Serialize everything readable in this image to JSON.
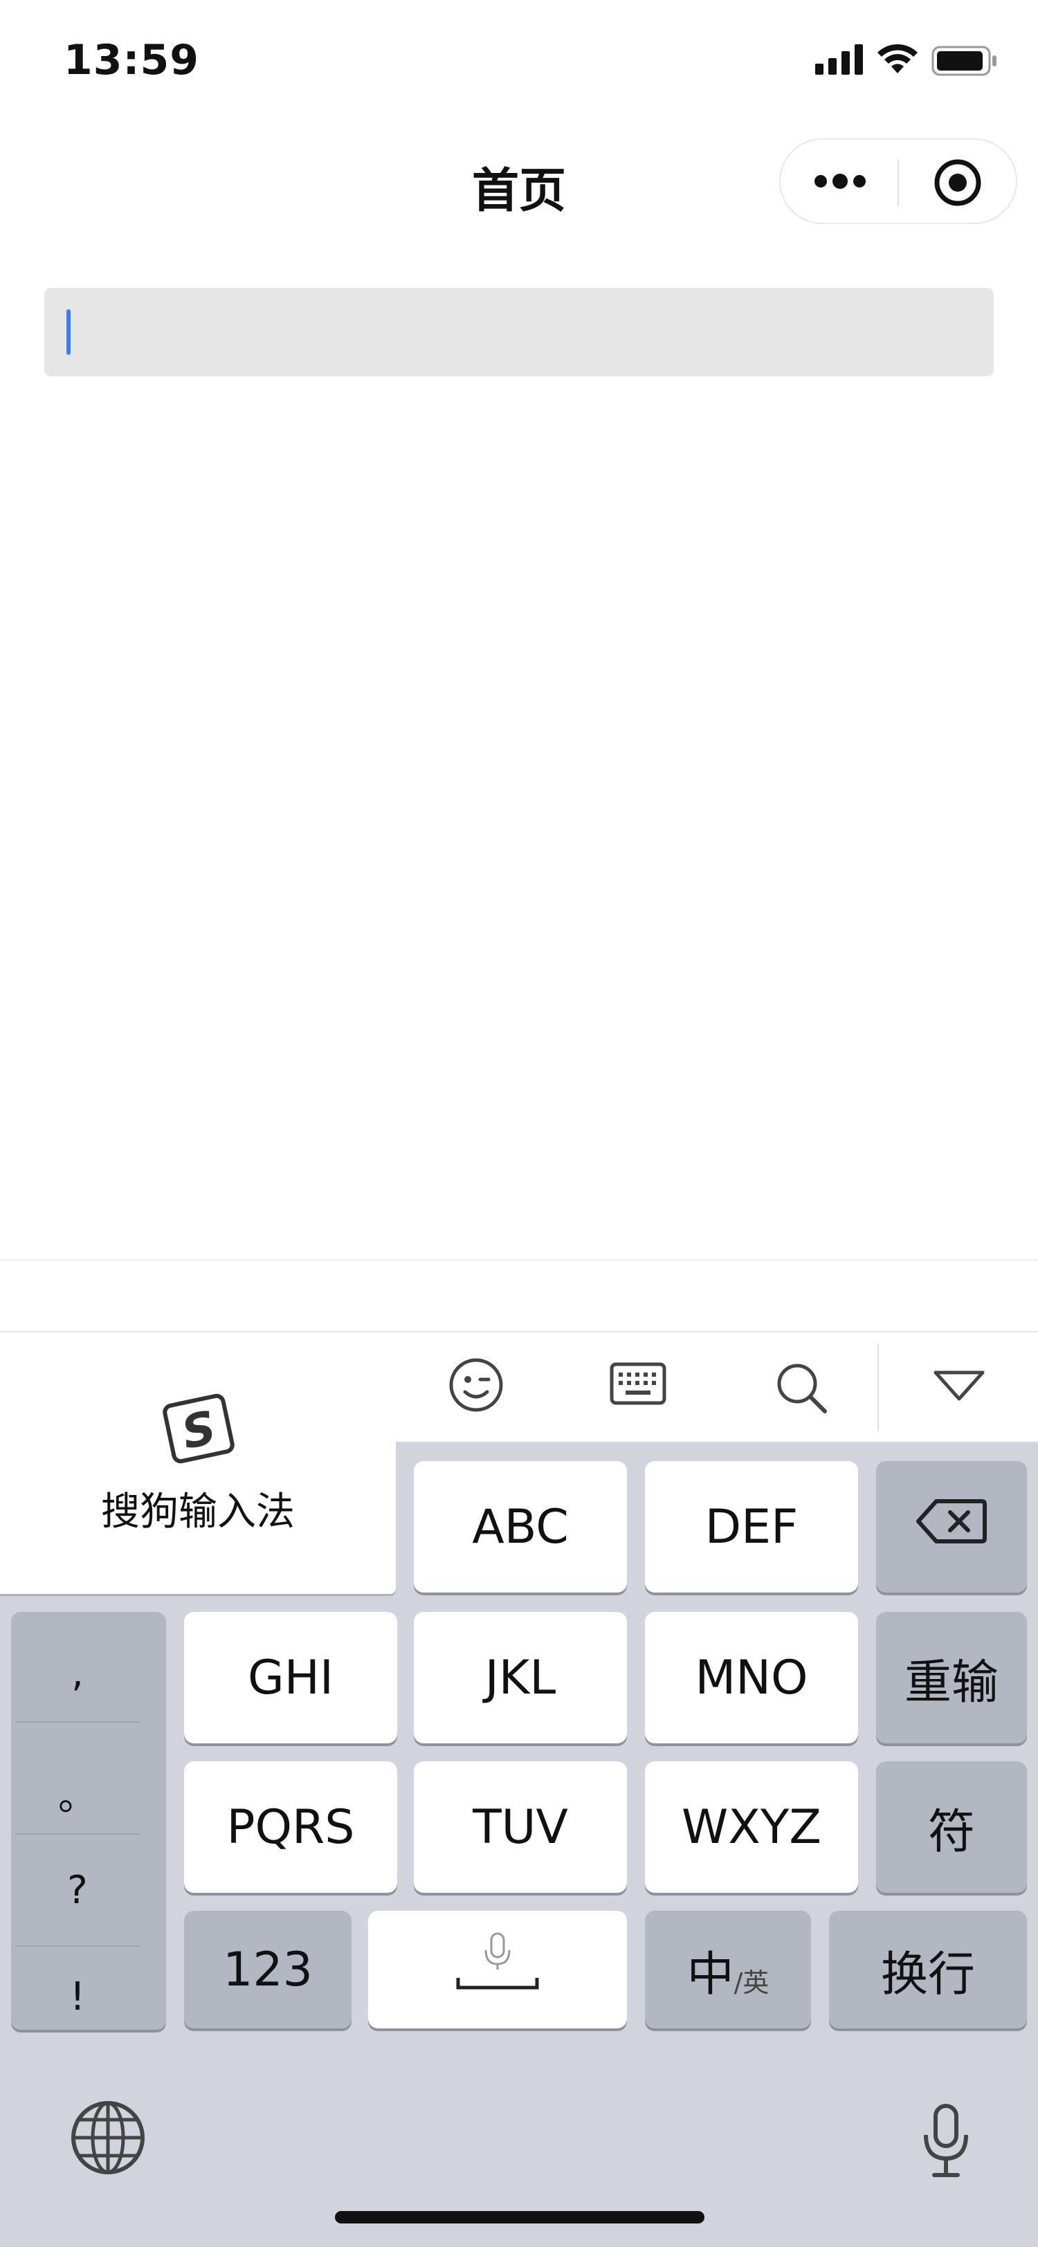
{
  "status_bar": {
    "time": "13:59"
  },
  "nav": {
    "title": "首页"
  },
  "search": {
    "value": "",
    "placeholder": ""
  },
  "keyboard": {
    "ime_name": "搜狗输入法",
    "keys": {
      "abc": "ABC",
      "def": "DEF",
      "ghi": "GHI",
      "jkl": "JKL",
      "mno": "MNO",
      "pqrs": "PQRS",
      "tuv": "TUV",
      "wxyz": "WXYZ",
      "retype": "重输",
      "symbols": "符",
      "numbers": "123",
      "lang_main": "中",
      "lang_sub": "/英",
      "newline": "换行"
    },
    "punctuation": [
      ",",
      "。",
      "?",
      "!"
    ],
    "icons": [
      "emoji-icon",
      "keyboard-layout-icon",
      "search-icon",
      "hide-keyboard-icon",
      "delete-icon",
      "globe-icon",
      "microphone-icon"
    ]
  },
  "colors": {
    "cursor": "#3b7cf5",
    "keyboard_bg": "#d1d4dc",
    "key_dark": "#b3b7c1"
  }
}
